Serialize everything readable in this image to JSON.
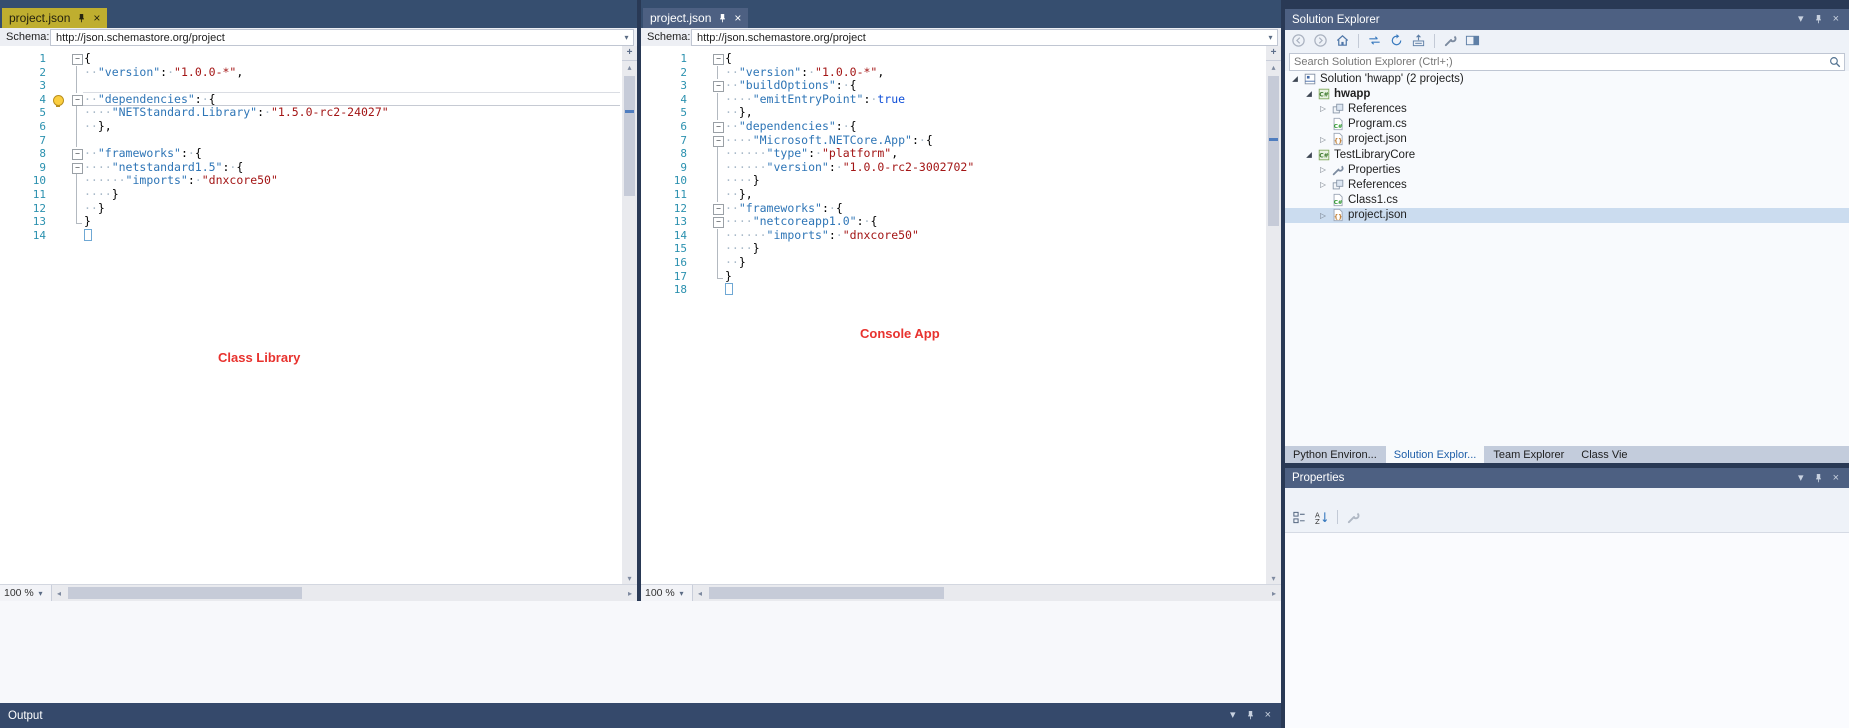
{
  "colors": {
    "frame": "#293955",
    "tab_strip": "#364E6F",
    "active_tab": "#BFAE2F",
    "inactive_group_tab": "#4D6082",
    "tool_window_title": "#4D6082",
    "selection_highlight": "#CBDCEF",
    "line_number": "#2B91AF",
    "json_property": "#2E75B6",
    "json_string": "#A31515",
    "json_keyword": "#0F4FD8",
    "annotation_red": "#E8322E"
  },
  "icons": {
    "chevron-down": "▾",
    "close": "×",
    "scroll-up": "▴",
    "scroll-down": "▾",
    "scroll-left": "◂",
    "scroll-right": "▸",
    "expander-expanded": "◢",
    "expander-collapsed": "▷",
    "splitter": "+"
  },
  "editors": [
    {
      "tab": {
        "label": "project.json"
      },
      "schema": {
        "label": "Schema:",
        "value": "http://json.schemastore.org/project"
      },
      "annotation": {
        "text": "Class Library"
      },
      "zoom": "100 %",
      "lines": [
        {
          "n": 1,
          "o": "minus",
          "t": [
            [
              "p",
              "{"
            ]
          ]
        },
        {
          "n": 2,
          "o": "line",
          "t": [
            [
              "w",
              "··"
            ],
            [
              "k",
              "\"version\""
            ],
            [
              "p",
              ":"
            ],
            [
              "w",
              "·"
            ],
            [
              "s",
              "\"1.0.0-*\""
            ],
            [
              "p",
              ","
            ]
          ]
        },
        {
          "n": 3,
          "o": "line",
          "t": []
        },
        {
          "n": 4,
          "o": "minus",
          "bulb": true,
          "cur": true,
          "t": [
            [
              "w",
              "··"
            ],
            [
              "k",
              "\"dependencies\""
            ],
            [
              "p",
              ":"
            ],
            [
              "w",
              "·"
            ],
            [
              "p",
              "{"
            ]
          ]
        },
        {
          "n": 5,
          "o": "line",
          "t": [
            [
              "w",
              "····"
            ],
            [
              "k",
              "\"NETStandard.Library\""
            ],
            [
              "p",
              ":"
            ],
            [
              "w",
              "·"
            ],
            [
              "s",
              "\"1.5.0-rc2-24027\""
            ]
          ]
        },
        {
          "n": 6,
          "o": "line",
          "t": [
            [
              "w",
              "··"
            ],
            [
              "p",
              "},"
            ]
          ]
        },
        {
          "n": 7,
          "o": "line",
          "t": []
        },
        {
          "n": 8,
          "o": "minus",
          "t": [
            [
              "w",
              "··"
            ],
            [
              "k",
              "\"frameworks\""
            ],
            [
              "p",
              ":"
            ],
            [
              "w",
              "·"
            ],
            [
              "p",
              "{"
            ]
          ]
        },
        {
          "n": 9,
          "o": "minus",
          "t": [
            [
              "w",
              "····"
            ],
            [
              "k",
              "\"netstandard1.5\""
            ],
            [
              "p",
              ":"
            ],
            [
              "w",
              "·"
            ],
            [
              "p",
              "{"
            ]
          ]
        },
        {
          "n": 10,
          "o": "line",
          "t": [
            [
              "w",
              "······"
            ],
            [
              "k",
              "\"imports\""
            ],
            [
              "p",
              ":"
            ],
            [
              "w",
              "·"
            ],
            [
              "s",
              "\"dnxcore50\""
            ]
          ]
        },
        {
          "n": 11,
          "o": "line",
          "t": [
            [
              "w",
              "····"
            ],
            [
              "p",
              "}"
            ]
          ]
        },
        {
          "n": 12,
          "o": "line",
          "t": [
            [
              "w",
              "··"
            ],
            [
              "p",
              "}"
            ]
          ]
        },
        {
          "n": 13,
          "o": "end",
          "t": [
            [
              "p",
              "}"
            ]
          ]
        },
        {
          "n": 14,
          "o": "none",
          "t": [
            [
              "x",
              ""
            ]
          ]
        }
      ]
    },
    {
      "tab": {
        "label": "project.json"
      },
      "schema": {
        "label": "Schema:",
        "value": "http://json.schemastore.org/project"
      },
      "annotation": {
        "text": "Console App"
      },
      "zoom": "100 %",
      "lines": [
        {
          "n": 1,
          "o": "minus",
          "t": [
            [
              "p",
              "{"
            ]
          ]
        },
        {
          "n": 2,
          "o": "line",
          "t": [
            [
              "w",
              "··"
            ],
            [
              "k",
              "\"version\""
            ],
            [
              "p",
              ":"
            ],
            [
              "w",
              "·"
            ],
            [
              "s",
              "\"1.0.0-*\""
            ],
            [
              "p",
              ","
            ]
          ]
        },
        {
          "n": 3,
          "o": "minus",
          "t": [
            [
              "w",
              "··"
            ],
            [
              "k",
              "\"buildOptions\""
            ],
            [
              "p",
              ":"
            ],
            [
              "w",
              "·"
            ],
            [
              "p",
              "{"
            ]
          ]
        },
        {
          "n": 4,
          "o": "line",
          "t": [
            [
              "w",
              "····"
            ],
            [
              "k",
              "\"emitEntryPoint\""
            ],
            [
              "p",
              ":"
            ],
            [
              "w",
              "·"
            ],
            [
              "b",
              "true"
            ]
          ]
        },
        {
          "n": 5,
          "o": "line",
          "t": [
            [
              "w",
              "··"
            ],
            [
              "p",
              "},"
            ]
          ]
        },
        {
          "n": 6,
          "o": "minus",
          "t": [
            [
              "w",
              "··"
            ],
            [
              "k",
              "\"dependencies\""
            ],
            [
              "p",
              ":"
            ],
            [
              "w",
              "·"
            ],
            [
              "p",
              "{"
            ]
          ]
        },
        {
          "n": 7,
          "o": "minus",
          "t": [
            [
              "w",
              "····"
            ],
            [
              "k",
              "\"Microsoft.NETCore.App\""
            ],
            [
              "p",
              ":"
            ],
            [
              "w",
              "·"
            ],
            [
              "p",
              "{"
            ]
          ]
        },
        {
          "n": 8,
          "o": "line",
          "t": [
            [
              "w",
              "······"
            ],
            [
              "k",
              "\"type\""
            ],
            [
              "p",
              ":"
            ],
            [
              "w",
              "·"
            ],
            [
              "s",
              "\"platform\""
            ],
            [
              "p",
              ","
            ]
          ]
        },
        {
          "n": 9,
          "o": "line",
          "t": [
            [
              "w",
              "······"
            ],
            [
              "k",
              "\"version\""
            ],
            [
              "p",
              ":"
            ],
            [
              "w",
              "·"
            ],
            [
              "s",
              "\"1.0.0-rc2-3002702\""
            ]
          ]
        },
        {
          "n": 10,
          "o": "line",
          "t": [
            [
              "w",
              "····"
            ],
            [
              "p",
              "}"
            ]
          ]
        },
        {
          "n": 11,
          "o": "line",
          "t": [
            [
              "w",
              "··"
            ],
            [
              "p",
              "},"
            ]
          ]
        },
        {
          "n": 12,
          "o": "minus",
          "t": [
            [
              "w",
              "··"
            ],
            [
              "k",
              "\"frameworks\""
            ],
            [
              "p",
              ":"
            ],
            [
              "w",
              "·"
            ],
            [
              "p",
              "{"
            ]
          ]
        },
        {
          "n": 13,
          "o": "minus",
          "t": [
            [
              "w",
              "····"
            ],
            [
              "k",
              "\"netcoreapp1.0\""
            ],
            [
              "p",
              ":"
            ],
            [
              "w",
              "·"
            ],
            [
              "p",
              "{"
            ]
          ]
        },
        {
          "n": 14,
          "o": "line",
          "t": [
            [
              "w",
              "······"
            ],
            [
              "k",
              "\"imports\""
            ],
            [
              "p",
              ":"
            ],
            [
              "w",
              "·"
            ],
            [
              "s",
              "\"dnxcore50\""
            ]
          ]
        },
        {
          "n": 15,
          "o": "line",
          "t": [
            [
              "w",
              "····"
            ],
            [
              "p",
              "}"
            ]
          ]
        },
        {
          "n": 16,
          "o": "line",
          "t": [
            [
              "w",
              "··"
            ],
            [
              "p",
              "}"
            ]
          ]
        },
        {
          "n": 17,
          "o": "end",
          "t": [
            [
              "p",
              "}"
            ]
          ]
        },
        {
          "n": 18,
          "o": "none",
          "t": [
            [
              "x",
              ""
            ]
          ]
        }
      ]
    }
  ],
  "output": {
    "title": "Output"
  },
  "solution_explorer": {
    "title": "Solution Explorer",
    "search_placeholder": "Search Solution Explorer (Ctrl+;)",
    "toolbar": [
      "back",
      "forward",
      "home",
      "sep",
      "sync-with-active-document",
      "refresh",
      "collapse-all",
      "sep",
      "properties",
      "preview-selected-items"
    ],
    "tree": [
      {
        "label": "Solution 'hwapp' (2 projects)",
        "icon": "solution",
        "arrow": "expanded",
        "indent": 0
      },
      {
        "label": "hwapp",
        "icon": "csproj",
        "arrow": "expanded",
        "indent": 1,
        "bold": true
      },
      {
        "label": "References",
        "icon": "references",
        "arrow": "collapsed",
        "indent": 2
      },
      {
        "label": "Program.cs",
        "icon": "csfile",
        "arrow": "none",
        "indent": 2
      },
      {
        "label": "project.json",
        "icon": "jsonfile",
        "arrow": "collapsed",
        "indent": 2
      },
      {
        "label": "TestLibraryCore",
        "icon": "csproj",
        "arrow": "expanded",
        "indent": 1
      },
      {
        "label": "Properties",
        "icon": "wrench",
        "arrow": "collapsed",
        "indent": 2
      },
      {
        "label": "References",
        "icon": "references",
        "arrow": "collapsed",
        "indent": 2
      },
      {
        "label": "Class1.cs",
        "icon": "csfile",
        "arrow": "none",
        "indent": 2
      },
      {
        "label": "project.json",
        "icon": "jsonfile",
        "arrow": "collapsed",
        "indent": 2,
        "selected": true
      }
    ],
    "tool_tabs": [
      {
        "label": "Python Environ...",
        "active": false
      },
      {
        "label": "Solution Explor...",
        "active": true
      },
      {
        "label": "Team Explorer",
        "active": false
      },
      {
        "label": "Class Vie",
        "active": false
      }
    ]
  },
  "properties_panel": {
    "title": "Properties",
    "toolbar": [
      "categorized",
      "alphabetical",
      "sep",
      "property-pages"
    ]
  }
}
